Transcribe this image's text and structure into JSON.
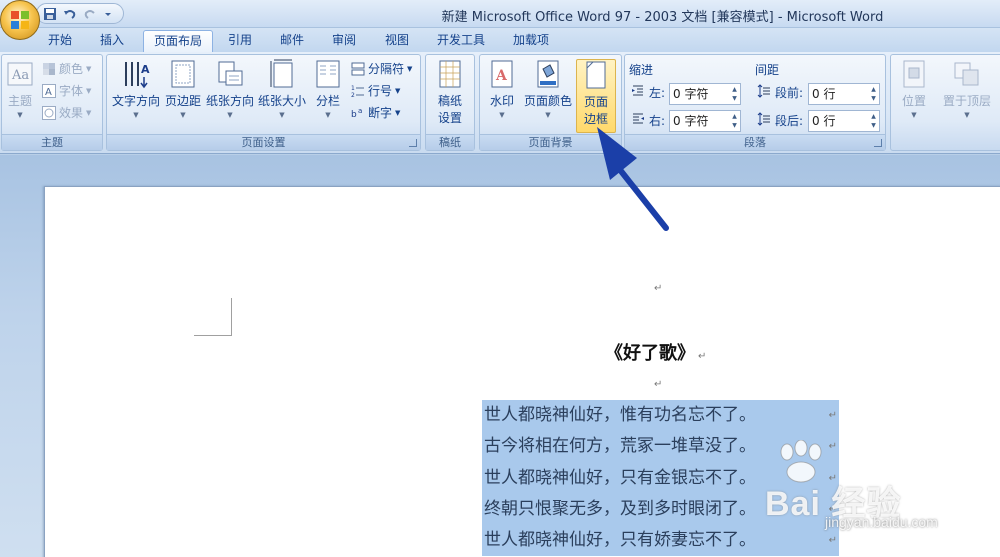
{
  "window": {
    "title": "新建 Microsoft Office Word 97 - 2003 文档 [兼容模式] - Microsoft Word"
  },
  "tabs": [
    {
      "label": "开始"
    },
    {
      "label": "插入"
    },
    {
      "label": "页面布局",
      "active": true
    },
    {
      "label": "引用"
    },
    {
      "label": "邮件"
    },
    {
      "label": "审阅"
    },
    {
      "label": "视图"
    },
    {
      "label": "开发工具"
    },
    {
      "label": "加载项"
    }
  ],
  "ribbon": {
    "theme": {
      "label": "主题",
      "themes": "主题",
      "colors": "颜色",
      "fonts": "字体",
      "effects": "效果"
    },
    "page_setup": {
      "label": "页面设置",
      "text_direction": "文字方向",
      "margins": "页边距",
      "orientation": "纸张方向",
      "size": "纸张大小",
      "columns": "分栏",
      "breaks": "分隔符",
      "line_numbers": "行号",
      "hyphenation": "断字"
    },
    "manuscript": {
      "label": "稿纸",
      "setup_line1": "稿纸",
      "setup_line2": "设置"
    },
    "page_background": {
      "label": "页面背景",
      "watermark": "水印",
      "page_color": "页面颜色",
      "borders_line1": "页面",
      "borders_line2": "边框"
    },
    "paragraph": {
      "label": "段落",
      "indent": "缩进",
      "spacing": "间距",
      "left": "左:",
      "right": "右:",
      "before": "段前:",
      "after": "段后:",
      "left_value": "0 字符",
      "right_value": "0 字符",
      "before_value": "0 行",
      "after_value": "0 行"
    },
    "arrange": {
      "position": "位置",
      "bring_front": "置于顶层"
    }
  },
  "document": {
    "title": "《好了歌》",
    "lines": [
      "世人都晓神仙好，惟有功名忘不了。",
      "古今将相在何方，荒冢一堆草没了。",
      "世人都晓神仙好，只有金银忘不了。",
      "终朝只恨聚无多，及到多时眼闭了。",
      "世人都晓神仙好，只有娇妻忘不了。"
    ],
    "paragraph_mark": "↵"
  },
  "watermark": {
    "brand": "Bai 经验",
    "url": "jingyan.baidu.com"
  },
  "colors": {
    "selection": "#a9c9ec",
    "arrow": "#1b3fa8",
    "highlight": "#ffd96b"
  }
}
